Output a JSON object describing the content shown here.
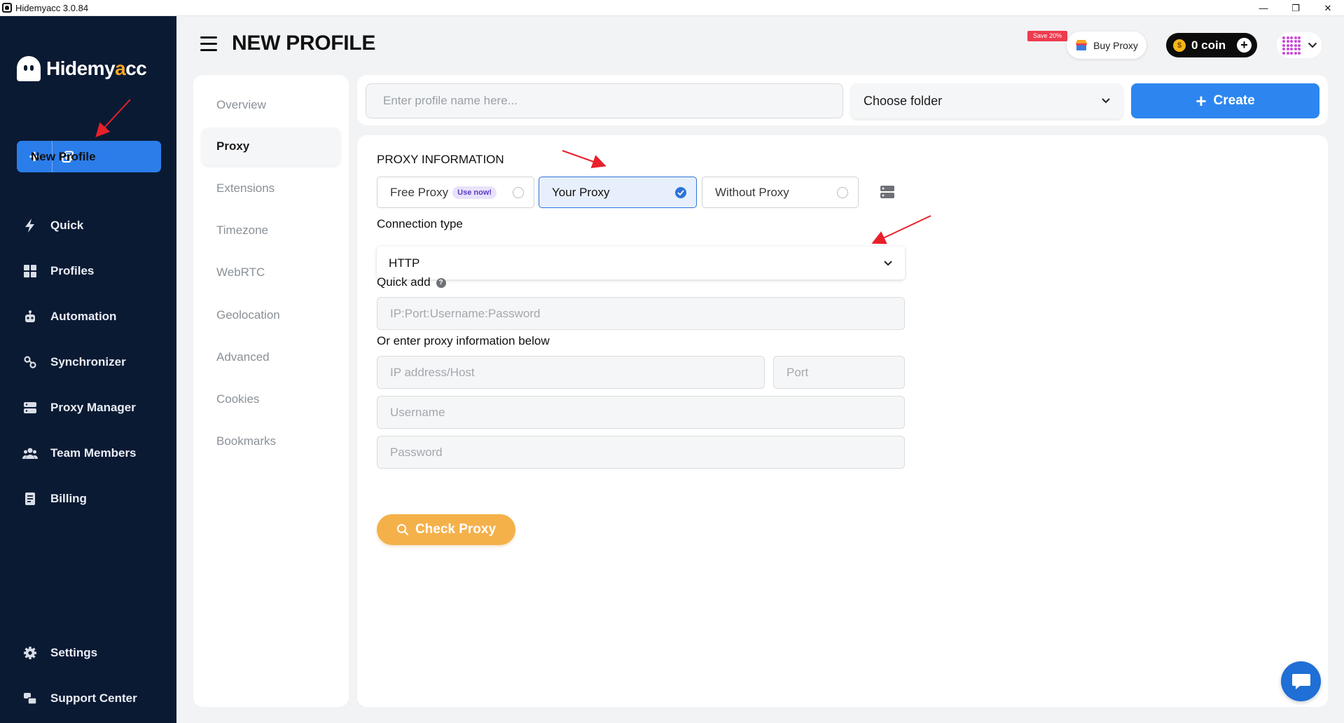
{
  "window": {
    "title": "Hidemyacc 3.0.84",
    "controls": {
      "minimize": "—",
      "maximize": "❐",
      "close": "✕"
    }
  },
  "brand": {
    "name_start": "Hidemy",
    "name_accent": "a",
    "name_end": "cc"
  },
  "sidebar": {
    "new_profile_label": "New Profile",
    "items": [
      {
        "label": "Quick",
        "icon": "lightning-icon"
      },
      {
        "label": "Profiles",
        "icon": "grid-icon"
      },
      {
        "label": "Automation",
        "icon": "robot-icon"
      },
      {
        "label": "Synchronizer",
        "icon": "sync-icon"
      },
      {
        "label": "Proxy Manager",
        "icon": "server-icon"
      },
      {
        "label": "Team Members",
        "icon": "team-icon"
      },
      {
        "label": "Billing",
        "icon": "receipt-icon"
      }
    ],
    "bottom_items": [
      {
        "label": "Settings",
        "icon": "gear-icon"
      },
      {
        "label": "Support Center",
        "icon": "support-icon"
      }
    ]
  },
  "header": {
    "title": "NEW PROFILE",
    "save_badge": "Save 20%",
    "buy_proxy_label": "Buy Proxy",
    "coin_label": "0 coin",
    "coin_symbol": "$",
    "coin_add": "+"
  },
  "tabs": [
    {
      "label": "Overview",
      "active": false
    },
    {
      "label": "Proxy",
      "active": true
    },
    {
      "label": "Extensions",
      "active": false
    },
    {
      "label": "Timezone",
      "active": false
    },
    {
      "label": "WebRTC",
      "active": false
    },
    {
      "label": "Geolocation",
      "active": false
    },
    {
      "label": "Advanced",
      "active": false
    },
    {
      "label": "Cookies",
      "active": false
    },
    {
      "label": "Bookmarks",
      "active": false
    }
  ],
  "topbar": {
    "name_placeholder": "Enter profile name here...",
    "folder_label": "Choose folder",
    "create_label": "Create",
    "create_plus": "+"
  },
  "proxy": {
    "section_title": "PROXY INFORMATION",
    "options": [
      {
        "label": "Free Proxy",
        "badge": "Use now!",
        "selected": false
      },
      {
        "label": "Your Proxy",
        "selected": true
      },
      {
        "label": "Without Proxy",
        "selected": false
      }
    ],
    "connection_type_label": "Connection type",
    "connection_type_value": "HTTP",
    "quick_add_label": "Quick add",
    "quick_add_help": "?",
    "quick_add_placeholder": "IP:Port:Username:Password",
    "manual_label": "Or enter proxy information below",
    "host_placeholder": "IP address/Host",
    "port_placeholder": "Port",
    "username_placeholder": "Username",
    "password_placeholder": "Password",
    "check_label": "Check Proxy"
  },
  "colors": {
    "sidebar_bg": "#0b1a33",
    "primary": "#2d86ef",
    "check_button": "#f4b14a",
    "annotation_arrow": "#e8202a"
  }
}
